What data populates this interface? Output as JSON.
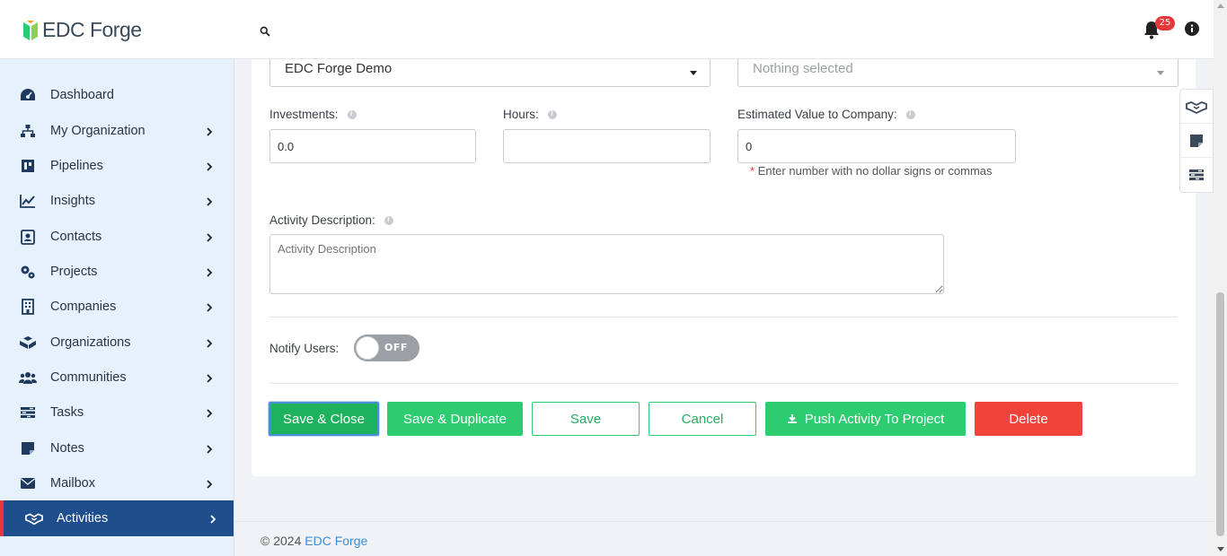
{
  "header": {
    "brand": "EDC Forge",
    "notification_count": "25"
  },
  "sidebar": {
    "items": [
      {
        "label": "Dashboard",
        "icon": "dashboard-icon"
      },
      {
        "label": "My Organization",
        "icon": "org-chart-icon"
      },
      {
        "label": "Pipelines",
        "icon": "pipeline-icon"
      },
      {
        "label": "Insights",
        "icon": "line-chart-icon"
      },
      {
        "label": "Contacts",
        "icon": "contact-card-icon"
      },
      {
        "label": "Projects",
        "icon": "gears-icon"
      },
      {
        "label": "Companies",
        "icon": "building-icon"
      },
      {
        "label": "Organizations",
        "icon": "cubes-icon"
      },
      {
        "label": "Communities",
        "icon": "users-icon"
      },
      {
        "label": "Tasks",
        "icon": "tasks-icon"
      },
      {
        "label": "Notes",
        "icon": "note-icon"
      },
      {
        "label": "Mailbox",
        "icon": "envelope-icon"
      },
      {
        "label": "Activities",
        "icon": "handshake-icon"
      }
    ],
    "active": "Activities"
  },
  "form": {
    "organization_select": "EDC Forge Demo",
    "second_select_placeholder": "Nothing selected",
    "investments_label": "Investments:",
    "investments_value": "0.0",
    "hours_label": "Hours:",
    "hours_value": "",
    "estimated_value_label": "Estimated Value to Company:",
    "estimated_value": "0",
    "estimated_hint_req": "*",
    "estimated_hint": " Enter number with no dollar signs or commas",
    "description_label": "Activity Description:",
    "description_placeholder": "Activity Description",
    "notify_label": "Notify Users:",
    "notify_state": "OFF"
  },
  "buttons": {
    "save_close": "Save & Close",
    "save_duplicate": "Save & Duplicate",
    "save": "Save",
    "cancel": "Cancel",
    "push_to_project": "Push Activity To Project",
    "delete": "Delete"
  },
  "footer": {
    "copyright": "© 2024",
    "brand_link": "EDC Forge"
  },
  "colors": {
    "active_nav": "#1f4e8c",
    "accent_red": "#e5383b",
    "button_green": "#2ecc71",
    "delete_red": "#f0433a",
    "link_blue": "#3a8fd6"
  }
}
